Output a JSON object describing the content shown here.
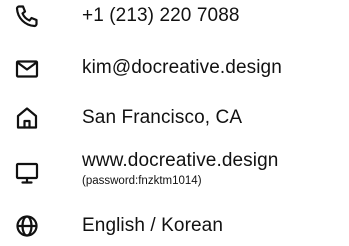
{
  "contacts": {
    "phone": {
      "icon": "phone-icon",
      "value": "+1 (213) 220 7088"
    },
    "email": {
      "icon": "envelope-icon",
      "value": "kim@docreative.design"
    },
    "location": {
      "icon": "home-icon",
      "value": "San Francisco, CA"
    },
    "website": {
      "icon": "monitor-icon",
      "value": "www.docreative.design",
      "note": "(password:fnzktm1014)"
    },
    "languages": {
      "icon": "globe-icon",
      "value": "English / Korean"
    }
  },
  "colors": {
    "text": "#111111",
    "icon": "#111111",
    "background": "#ffffff"
  }
}
